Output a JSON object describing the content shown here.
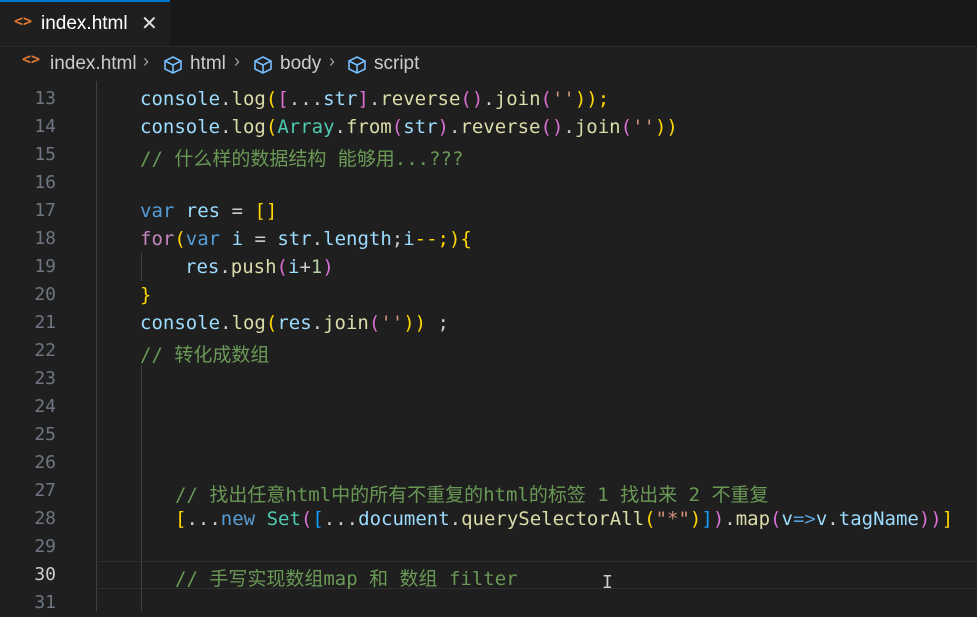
{
  "tab": {
    "label": "index.html",
    "close": "✕",
    "icon": "html-file-icon"
  },
  "breadcrumb": {
    "file": "index.html",
    "items": [
      "html",
      "body",
      "script"
    ],
    "separator": "›"
  },
  "editor": {
    "active_line": "30",
    "lines": [
      {
        "n": "13"
      },
      {
        "n": "14"
      },
      {
        "n": "15"
      },
      {
        "n": "16"
      },
      {
        "n": "17"
      },
      {
        "n": "18"
      },
      {
        "n": "19"
      },
      {
        "n": "20"
      },
      {
        "n": "21"
      },
      {
        "n": "22"
      },
      {
        "n": "23"
      },
      {
        "n": "24"
      },
      {
        "n": "25"
      },
      {
        "n": "26"
      },
      {
        "n": "27"
      },
      {
        "n": "28"
      },
      {
        "n": "29"
      },
      {
        "n": "30"
      },
      {
        "n": "31"
      }
    ],
    "code": {
      "l13": [
        "console",
        ".",
        "log",
        "(",
        "[",
        "...",
        "str",
        "]",
        ".",
        "reverse",
        "()",
        ".",
        "join",
        "(",
        "''",
        "));"
      ],
      "l14": [
        "console",
        ".",
        "log",
        "(",
        "Array",
        ".",
        "from",
        "(",
        "str",
        ")",
        ".",
        "reverse",
        "()",
        ".",
        "join",
        "(",
        "''",
        "))"
      ],
      "l15": "// 什么样的数据结构 能够用...???",
      "l17": [
        "var",
        " ",
        "res",
        " = ",
        "[]"
      ],
      "l18": [
        "for",
        "(",
        "var",
        " ",
        "i",
        " = ",
        "str",
        ".",
        "length",
        ";",
        "i",
        "--;){"
      ],
      "l19": [
        "res",
        ".",
        "push",
        "(",
        "i",
        "+",
        "1",
        ")"
      ],
      "l20": "}",
      "l21": [
        "console",
        ".",
        "log",
        "(",
        "res",
        ".",
        "join",
        "(",
        "''",
        "))",
        " ;"
      ],
      "l22": "// 转化成数组",
      "l27": "// 找出任意html中的所有不重复的html的标签 1 找出来 2 不重复",
      "l28": [
        "[",
        "...",
        "new",
        " ",
        "Set",
        "(",
        "[",
        "...",
        "document",
        ".",
        "querySelectorAll",
        "(",
        "\"*\"",
        ")",
        "]",
        ")",
        ".",
        "map",
        "(",
        "v",
        "=>",
        "v",
        ".",
        "tagName",
        ")",
        ")",
        "]"
      ],
      "l30": "// 手写实现数组map 和 数组 filter"
    }
  },
  "cursor": "I"
}
